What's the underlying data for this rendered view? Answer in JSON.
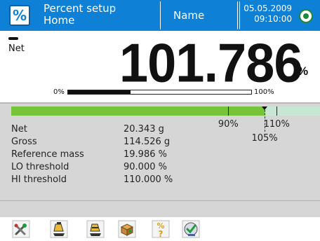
{
  "header": {
    "mode_title": "Percent setup",
    "mode_subtitle": "Home",
    "mode_icon": "percent-icon",
    "user_name": "Name",
    "date": "05.05.2009",
    "time": "09:10:00",
    "status_icon": "level-ok-icon"
  },
  "reading": {
    "net_label": "Net",
    "value": "101.786",
    "unit": "%",
    "range_min_label": "0%",
    "range_max_label": "100%",
    "range_fill_fraction": 0.34
  },
  "threshold_bar": {
    "lo_label": "90%",
    "hi_label": "110%",
    "current_label": "105%",
    "lo_value": 90,
    "hi_value": 110,
    "current_value": 105
  },
  "info_rows": [
    {
      "label": "Net",
      "value": "20.343 g"
    },
    {
      "label": "Gross",
      "value": "114.526 g"
    },
    {
      "label": "Reference mass",
      "value": "19.986 %"
    },
    {
      "label": "LO threshold",
      "value": "90.000 %"
    },
    {
      "label": "HI threshold",
      "value": "110.000 %"
    }
  ],
  "toolbar": {
    "buttons": [
      {
        "icon": "tools-icon"
      },
      {
        "icon": "tare-icon"
      },
      {
        "icon": "tare-minus-icon"
      },
      {
        "icon": "package-icon"
      },
      {
        "icon": "percent-help-icon"
      },
      {
        "icon": "check-icon"
      }
    ]
  },
  "colors": {
    "header_bg": "#0e80d6",
    "threshold_ok": "#75c43a",
    "threshold_over": "#c7e6d4",
    "info_bg": "#d6d6d6"
  }
}
